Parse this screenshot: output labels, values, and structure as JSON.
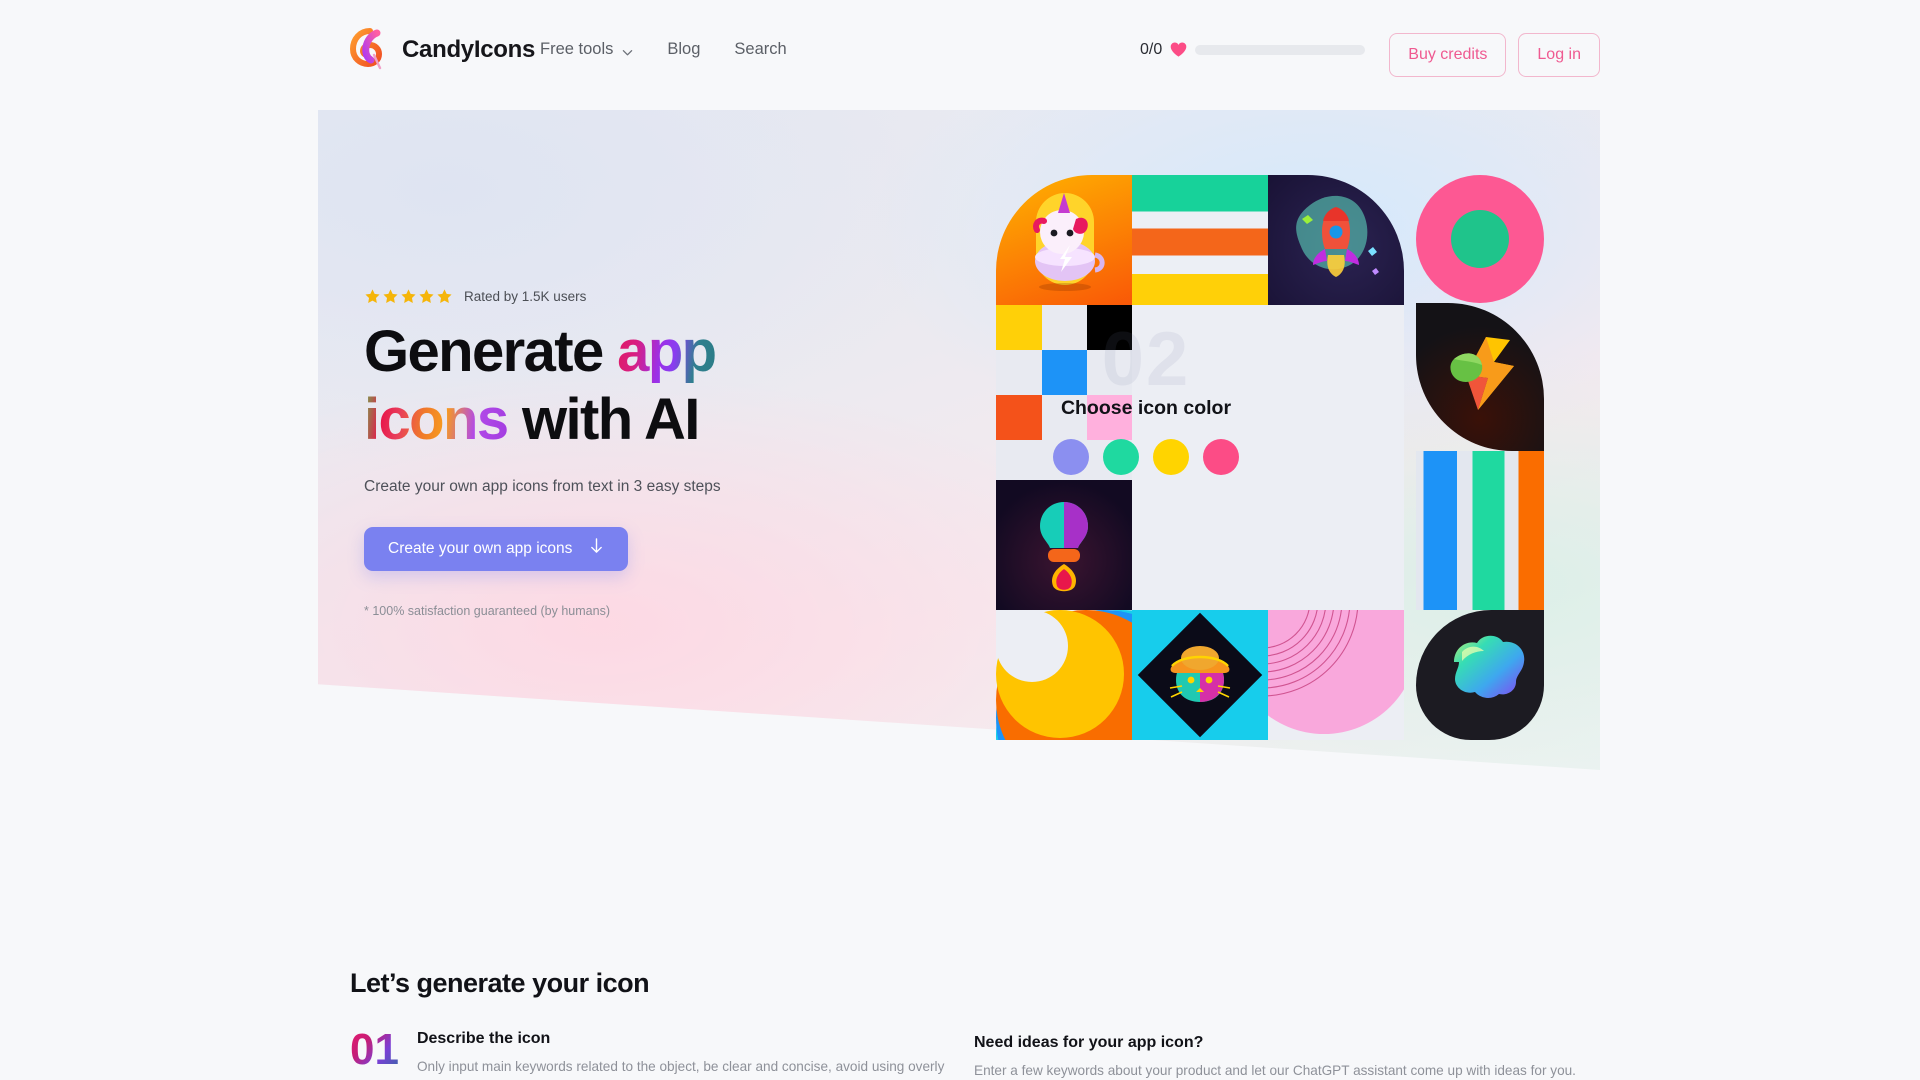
{
  "brand": {
    "name": "CandyIcons",
    "logo_icon": "lollipop-icon"
  },
  "nav": {
    "items": [
      {
        "label": "Free tools",
        "icon": "chevron-down-icon",
        "has_chevron": true
      },
      {
        "label": "Blog",
        "has_chevron": false
      },
      {
        "label": "Search",
        "has_chevron": false
      }
    ]
  },
  "credits": {
    "value": "0/0",
    "icon": "heart-icon",
    "progress_pct": 0
  },
  "header_buttons": {
    "buy": "Buy credits",
    "login": "Log in"
  },
  "hero": {
    "rating_text": "Rated by 1.5K users",
    "stars": 5,
    "star_icon": "star-icon",
    "headline_line1_plain": "Generate ",
    "headline_line1_accent": "app",
    "headline_line2_accent": "icons",
    "headline_line2_plain": " with AI",
    "subtitle": "Create your own app icons from text in 3 easy steps",
    "cta_label": "Create your own app icons",
    "cta_icon": "arrow-down-icon",
    "note": "* 100% satisfaction guaranteed (by humans)"
  },
  "picker": {
    "watermark": "02",
    "title": "Choose icon color",
    "swatches": [
      "#8b8ff0",
      "#1fd9a0",
      "#ffd400",
      "#fc4c86"
    ]
  },
  "colors": {
    "accent_pink": "#ef5a91",
    "cta_purple": "#7a81f0",
    "green": "#17d29a",
    "orange": "#f4661a",
    "yellow": "#ffd008",
    "blue": "#1d93f7",
    "hot_pink": "#fd5893",
    "light_pink": "#f9a8dc",
    "cyan": "#17cdec"
  },
  "section": {
    "title": "Let’s generate your icon",
    "steps": [
      {
        "number": "01",
        "title": "Describe the icon",
        "desc": "Only input main keywords related to the object, be clear and concise, avoid using overly"
      }
    ],
    "ideas": {
      "title": "Need ideas for your app icon?",
      "desc": "Enter a few keywords about your product and let our ChatGPT assistant come up with ideas for you."
    }
  }
}
